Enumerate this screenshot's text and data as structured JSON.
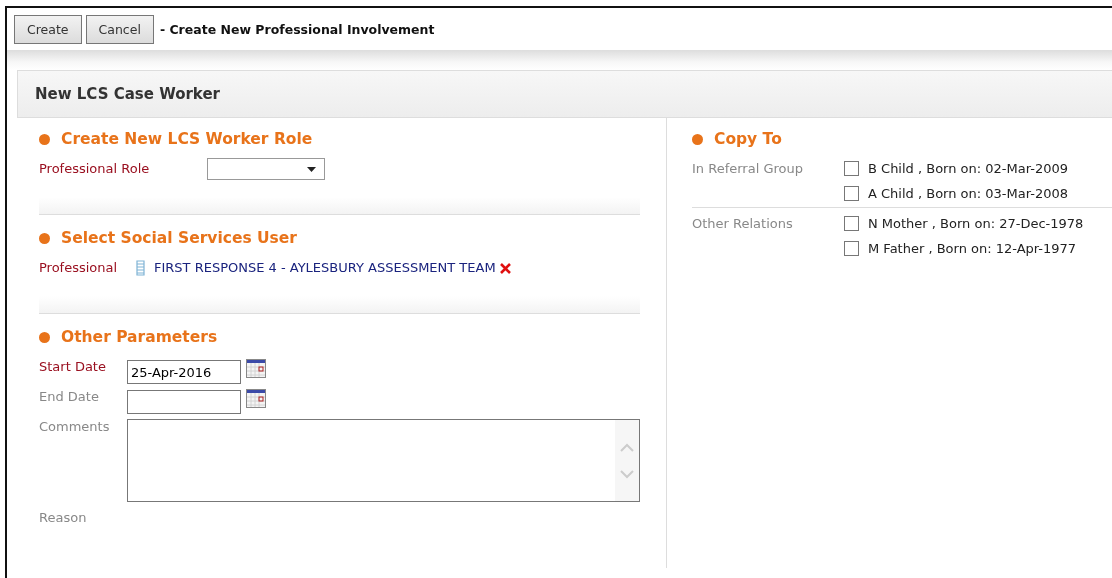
{
  "toolbar": {
    "buttons": [
      "Create",
      "Cancel"
    ],
    "title": "- Create New Professional Involvement"
  },
  "panel": {
    "title": "New LCS Case Worker"
  },
  "left_sections": [
    {
      "title": "Create New LCS Worker Role",
      "fields": [
        {
          "kind": "select",
          "label": "Professional Role",
          "required": true
        }
      ]
    },
    {
      "title": "Select Social Services User",
      "fields": [
        {
          "kind": "link",
          "label": "Professional",
          "required": true,
          "value": "FIRST RESPONSE 4 - AYLESBURY ASSESSMENT TEAM"
        }
      ]
    },
    {
      "title": "Other Parameters",
      "fields": [
        {
          "kind": "date",
          "label": "Start Date",
          "required": true,
          "value": "25-Apr-2016"
        },
        {
          "kind": "date",
          "label": "End Date",
          "required": false
        },
        {
          "kind": "textarea",
          "label": "Comments",
          "required": false
        },
        {
          "kind": "label",
          "label": "Reason",
          "required": false
        }
      ]
    }
  ],
  "copy_to": {
    "title": "Copy To",
    "groups": [
      {
        "label": "In Referral Group",
        "people": [
          {
            "text": "B Child , Born on: 02-Mar-2009",
            "checked": false
          },
          {
            "text": "A Child , Born on: 03-Mar-2008",
            "checked": false
          }
        ]
      },
      {
        "label": "Other Relations",
        "people": [
          {
            "text": "N Mother , Born on: 27-Dec-1978",
            "checked": false
          },
          {
            "text": "M Father , Born on: 12-Apr-1977",
            "checked": false
          }
        ]
      }
    ]
  }
}
